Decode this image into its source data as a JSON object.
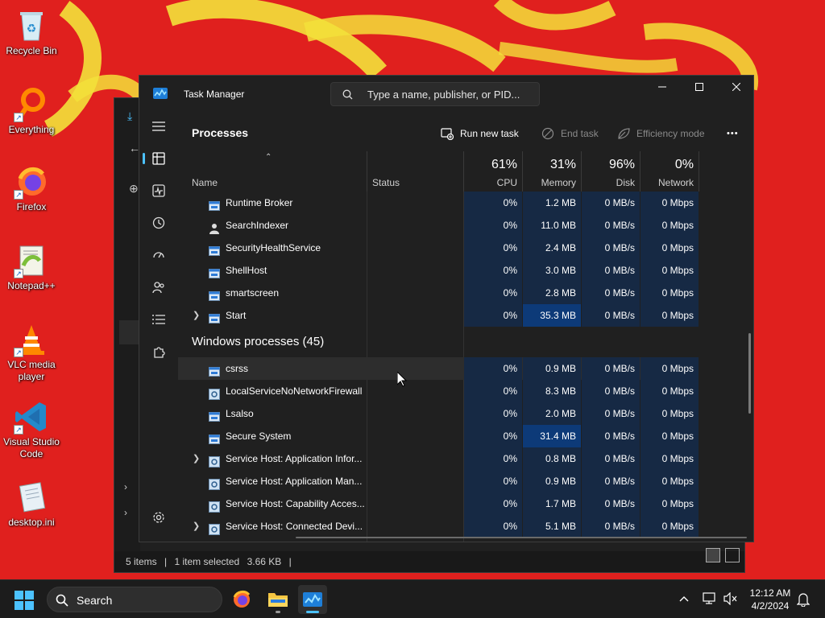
{
  "desktop": {
    "icons": [
      {
        "label": "Recycle Bin",
        "icon": "recycle-bin-icon"
      },
      {
        "label": "Everything",
        "icon": "everything-search-icon"
      },
      {
        "label": "Firefox",
        "icon": "firefox-icon"
      },
      {
        "label": "Notepad++",
        "icon": "notepad-plus-plus-icon"
      },
      {
        "label": "VLC media player",
        "icon": "vlc-icon"
      },
      {
        "label": "Visual Studio Code",
        "icon": "vscode-icon"
      },
      {
        "label": "desktop.ini",
        "icon": "ini-file-icon"
      }
    ]
  },
  "explorer": {
    "status": {
      "items": "5 items",
      "selected": "1 item selected",
      "size": "3.66 KB",
      "sep": "|"
    }
  },
  "task_manager": {
    "title": "Task Manager",
    "search_placeholder": "Type a name, publisher, or PID...",
    "page_title": "Processes",
    "toolbar": {
      "run_new_task": "Run new task",
      "end_task": "End task",
      "efficiency_mode": "Efficiency mode",
      "more": "•••"
    },
    "columns": {
      "name": "Name",
      "status": "Status",
      "cpu": {
        "pct": "61%",
        "label": "CPU"
      },
      "memory": {
        "pct": "31%",
        "label": "Memory"
      },
      "disk": {
        "pct": "96%",
        "label": "Disk"
      },
      "network": {
        "pct": "0%",
        "label": "Network"
      }
    },
    "background_rows": [
      {
        "name": "Runtime Broker",
        "cpu": "0%",
        "mem": "1.2 MB",
        "disk": "0 MB/s",
        "net": "0 Mbps"
      },
      {
        "name": "SearchIndexer",
        "cpu": "0%",
        "mem": "11.0 MB",
        "disk": "0 MB/s",
        "net": "0 Mbps"
      },
      {
        "name": "SecurityHealthService",
        "cpu": "0%",
        "mem": "2.4 MB",
        "disk": "0 MB/s",
        "net": "0 Mbps"
      },
      {
        "name": "ShellHost",
        "cpu": "0%",
        "mem": "3.0 MB",
        "disk": "0 MB/s",
        "net": "0 Mbps"
      },
      {
        "name": "smartscreen",
        "cpu": "0%",
        "mem": "2.8 MB",
        "disk": "0 MB/s",
        "net": "0 Mbps"
      },
      {
        "name": "Start",
        "cpu": "0%",
        "mem": "35.3 MB",
        "disk": "0 MB/s",
        "net": "0 Mbps"
      }
    ],
    "group_title": "Windows processes (45)",
    "windows_rows": [
      {
        "name": "csrss",
        "cpu": "0%",
        "mem": "0.9 MB",
        "disk": "0 MB/s",
        "net": "0 Mbps"
      },
      {
        "name": "LocalServiceNoNetworkFirewall",
        "cpu": "0%",
        "mem": "8.3 MB",
        "disk": "0 MB/s",
        "net": "0 Mbps"
      },
      {
        "name": "Lsalso",
        "cpu": "0%",
        "mem": "2.0 MB",
        "disk": "0 MB/s",
        "net": "0 Mbps"
      },
      {
        "name": "Secure System",
        "cpu": "0%",
        "mem": "31.4 MB",
        "disk": "0 MB/s",
        "net": "0 Mbps"
      },
      {
        "name": "Service Host: Application Infor...",
        "cpu": "0%",
        "mem": "0.8 MB",
        "disk": "0 MB/s",
        "net": "0 Mbps"
      },
      {
        "name": "Service Host: Application Man...",
        "cpu": "0%",
        "mem": "0.9 MB",
        "disk": "0 MB/s",
        "net": "0 Mbps"
      },
      {
        "name": "Service Host: Capability Acces...",
        "cpu": "0%",
        "mem": "1.7 MB",
        "disk": "0 MB/s",
        "net": "0 Mbps"
      },
      {
        "name": "Service Host: Connected Devi...",
        "cpu": "0%",
        "mem": "5.1 MB",
        "disk": "0 MB/s",
        "net": "0 Mbps"
      }
    ]
  },
  "taskbar": {
    "search_label": "Search",
    "time": "12:12 AM",
    "date": "4/2/2024"
  },
  "colors": {
    "accent": "#4cc2ff",
    "heat_low": "#162944",
    "heat_high": "#0d3a78",
    "wallpaper_red": "#e0201e",
    "wallpaper_yellow": "#f3e13a"
  }
}
